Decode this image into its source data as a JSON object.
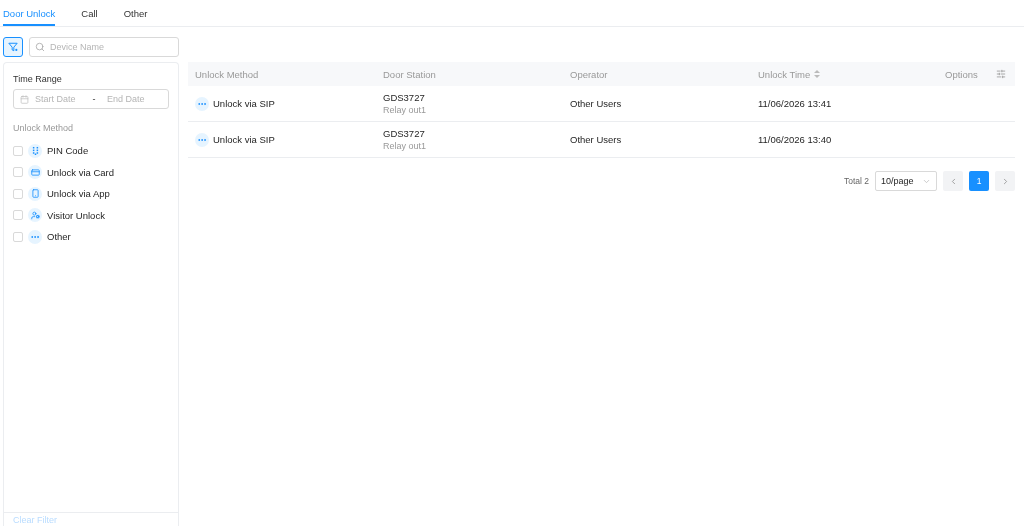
{
  "tabs": [
    {
      "label": "Door Unlock",
      "selected": true
    },
    {
      "label": "Call",
      "selected": false
    },
    {
      "label": "Other",
      "selected": false
    }
  ],
  "toolbar": {
    "filter_toggle": {
      "on": true
    },
    "search": {
      "placeholder": "Device Name"
    }
  },
  "filter_panel": {
    "time_range": {
      "label": "Time Range",
      "start_placeholder": "Start Date",
      "separator": "-",
      "end_placeholder": "End Date"
    },
    "unlock_method": {
      "label": "Unlock Method",
      "options": [
        {
          "label": "PIN Code",
          "kind": "pin",
          "checked": false
        },
        {
          "label": "Unlock via Card",
          "kind": "card",
          "checked": false
        },
        {
          "label": "Unlock via App",
          "kind": "app",
          "checked": false
        },
        {
          "label": "Visitor Unlock",
          "kind": "visitor",
          "checked": false
        },
        {
          "label": "Other",
          "kind": "other",
          "checked": false
        }
      ]
    },
    "clear_filter": {
      "label": "Clear Filter",
      "disabled": true
    }
  },
  "table": {
    "columns": [
      {
        "label": "Unlock Method",
        "sortable": false
      },
      {
        "label": "Door Station",
        "sortable": false
      },
      {
        "label": "Operator",
        "sortable": false
      },
      {
        "label": "Unlock Time",
        "sortable": true
      },
      {
        "label": "Options",
        "sortable": false
      }
    ],
    "rows": [
      {
        "method": {
          "label": "Unlock via SIP",
          "kind": "other"
        },
        "door_station": "GDS3727",
        "relay": "Relay out1",
        "operator": "Other Users",
        "unlock_time": "11/06/2026 13:41"
      },
      {
        "method": {
          "label": "Unlock via SIP",
          "kind": "other"
        },
        "door_station": "GDS3727",
        "relay": "Relay out1",
        "operator": "Other Users",
        "unlock_time": "11/06/2026 13:40"
      }
    ]
  },
  "pagination": {
    "total": "Total 2",
    "page_size": "10/page",
    "pages": [
      {
        "label": "1",
        "selected": true
      }
    ]
  }
}
